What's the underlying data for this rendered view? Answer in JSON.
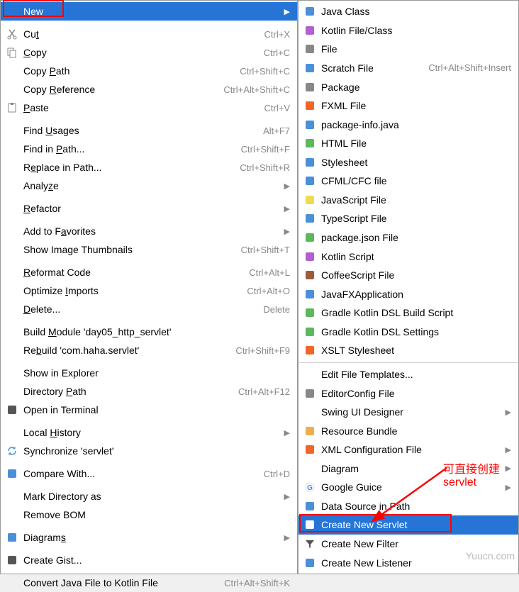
{
  "left_menu": {
    "groups": [
      [
        {
          "label": "New",
          "icon": "blank",
          "submenu": true,
          "selected": true,
          "ul": 0
        }
      ],
      [
        {
          "label": "Cut",
          "icon": "cut",
          "shortcut": "Ctrl+X",
          "ul": 2
        },
        {
          "label": "Copy",
          "icon": "copy",
          "shortcut": "Ctrl+C",
          "ul": 0
        },
        {
          "label": "Copy Path",
          "shortcut": "Ctrl+Shift+C",
          "ul": 5
        },
        {
          "label": "Copy Reference",
          "shortcut": "Ctrl+Alt+Shift+C",
          "ul": 5
        },
        {
          "label": "Paste",
          "icon": "paste",
          "shortcut": "Ctrl+V",
          "ul": 0
        }
      ],
      [
        {
          "label": "Find Usages",
          "shortcut": "Alt+F7",
          "ul": 5
        },
        {
          "label": "Find in Path...",
          "shortcut": "Ctrl+Shift+F",
          "ul": 8
        },
        {
          "label": "Replace in Path...",
          "shortcut": "Ctrl+Shift+R",
          "ul": 1
        },
        {
          "label": "Analyze",
          "submenu": true,
          "ul": 5
        }
      ],
      [
        {
          "label": "Refactor",
          "submenu": true,
          "ul": 0
        }
      ],
      [
        {
          "label": "Add to Favorites",
          "submenu": true,
          "ul": 8
        },
        {
          "label": "Show Image Thumbnails",
          "shortcut": "Ctrl+Shift+T"
        }
      ],
      [
        {
          "label": "Reformat Code",
          "shortcut": "Ctrl+Alt+L",
          "ul": 0
        },
        {
          "label": "Optimize Imports",
          "shortcut": "Ctrl+Alt+O",
          "ul": 9
        },
        {
          "label": "Delete...",
          "shortcut": "Delete",
          "ul": 0
        }
      ],
      [
        {
          "label": "Build Module 'day05_http_servlet'",
          "ul": 6
        },
        {
          "label": "Rebuild 'com.haha.servlet'",
          "shortcut": "Ctrl+Shift+F9",
          "ul": 2
        }
      ],
      [
        {
          "label": "Show in Explorer"
        },
        {
          "label": "Directory Path",
          "shortcut": "Ctrl+Alt+F12",
          "ul": 10
        },
        {
          "label": "Open in Terminal",
          "icon": "terminal"
        }
      ],
      [
        {
          "label": "Local History",
          "submenu": true,
          "ul": 6
        },
        {
          "label": "Synchronize 'servlet'",
          "icon": "sync"
        }
      ],
      [
        {
          "label": "Compare With...",
          "icon": "compare",
          "shortcut": "Ctrl+D"
        }
      ],
      [
        {
          "label": "Mark Directory as",
          "submenu": true
        },
        {
          "label": "Remove BOM"
        }
      ],
      [
        {
          "label": "Diagrams",
          "icon": "diagram",
          "submenu": true,
          "ul": 7
        }
      ],
      [
        {
          "label": "Create Gist...",
          "icon": "gist"
        }
      ],
      [
        {
          "label": "Convert Java File to Kotlin File",
          "shortcut": "Ctrl+Alt+Shift+K"
        }
      ]
    ]
  },
  "right_menu": {
    "groups": [
      [
        {
          "label": "Java Class",
          "icon": "java-class"
        },
        {
          "label": "Kotlin File/Class",
          "icon": "kotlin"
        },
        {
          "label": "File",
          "icon": "file"
        },
        {
          "label": "Scratch File",
          "icon": "scratch",
          "shortcut": "Ctrl+Alt+Shift+Insert"
        },
        {
          "label": "Package",
          "icon": "package"
        },
        {
          "label": "FXML File",
          "icon": "fxml"
        },
        {
          "label": "package-info.java",
          "icon": "pkginfo"
        },
        {
          "label": "HTML File",
          "icon": "html"
        },
        {
          "label": "Stylesheet",
          "icon": "css"
        },
        {
          "label": "CFML/CFC file",
          "icon": "cfml"
        },
        {
          "label": "JavaScript File",
          "icon": "js"
        },
        {
          "label": "TypeScript File",
          "icon": "ts"
        },
        {
          "label": "package.json File",
          "icon": "packagejson"
        },
        {
          "label": "Kotlin Script",
          "icon": "kotlin"
        },
        {
          "label": "CoffeeScript File",
          "icon": "coffee"
        },
        {
          "label": "JavaFXApplication",
          "icon": "javafx"
        },
        {
          "label": "Gradle Kotlin DSL Build Script",
          "icon": "gradle"
        },
        {
          "label": "Gradle Kotlin DSL Settings",
          "icon": "gradle"
        },
        {
          "label": "XSLT Stylesheet",
          "icon": "xslt"
        }
      ],
      [
        {
          "label": "Edit File Templates..."
        },
        {
          "label": "EditorConfig File",
          "icon": "editorconfig"
        },
        {
          "label": "Swing UI Designer",
          "submenu": true
        },
        {
          "label": "Resource Bundle",
          "icon": "bundle"
        },
        {
          "label": "XML Configuration File",
          "icon": "xml",
          "submenu": true
        },
        {
          "label": "Diagram",
          "submenu": true
        },
        {
          "label": "Google Guice",
          "icon": "google",
          "submenu": true
        },
        {
          "label": "Data Source in Path",
          "icon": "datasource"
        },
        {
          "label": "Create New Servlet",
          "icon": "servlet",
          "selected": true
        },
        {
          "label": "Create New Filter",
          "icon": "filter"
        },
        {
          "label": "Create New Listener",
          "icon": "listener"
        }
      ]
    ]
  },
  "annotations": {
    "text1": "可直接创建",
    "text2": "servlet",
    "watermark": "Yuucn.com"
  },
  "icons": {
    "cut": "#888",
    "copy": "#888",
    "paste": "#888",
    "terminal": "#555",
    "sync": "#4a90d9",
    "compare": "#4a90d9",
    "diagram": "#4a90d9",
    "gist": "#555",
    "java-class": "#4a90d9",
    "kotlin": "#b060d0",
    "file": "#888",
    "scratch": "#4a90d9",
    "package": "#888",
    "fxml": "#f16529",
    "pkginfo": "#4a90d9",
    "html": "#5cb85c",
    "css": "#4a90d9",
    "cfml": "#4a90d9",
    "js": "#f0db4f",
    "ts": "#4a90d9",
    "packagejson": "#5cb85c",
    "coffee": "#9c5e3a",
    "javafx": "#4a90d9",
    "gradle": "#5cb85c",
    "xslt": "#f16529",
    "editorconfig": "#888",
    "bundle": "#f0ad4e",
    "xml": "#f16529",
    "google": "#db4437",
    "datasource": "#4a90d9",
    "servlet": "#4a90d9",
    "filter": "#555",
    "listener": "#4a90d9"
  }
}
